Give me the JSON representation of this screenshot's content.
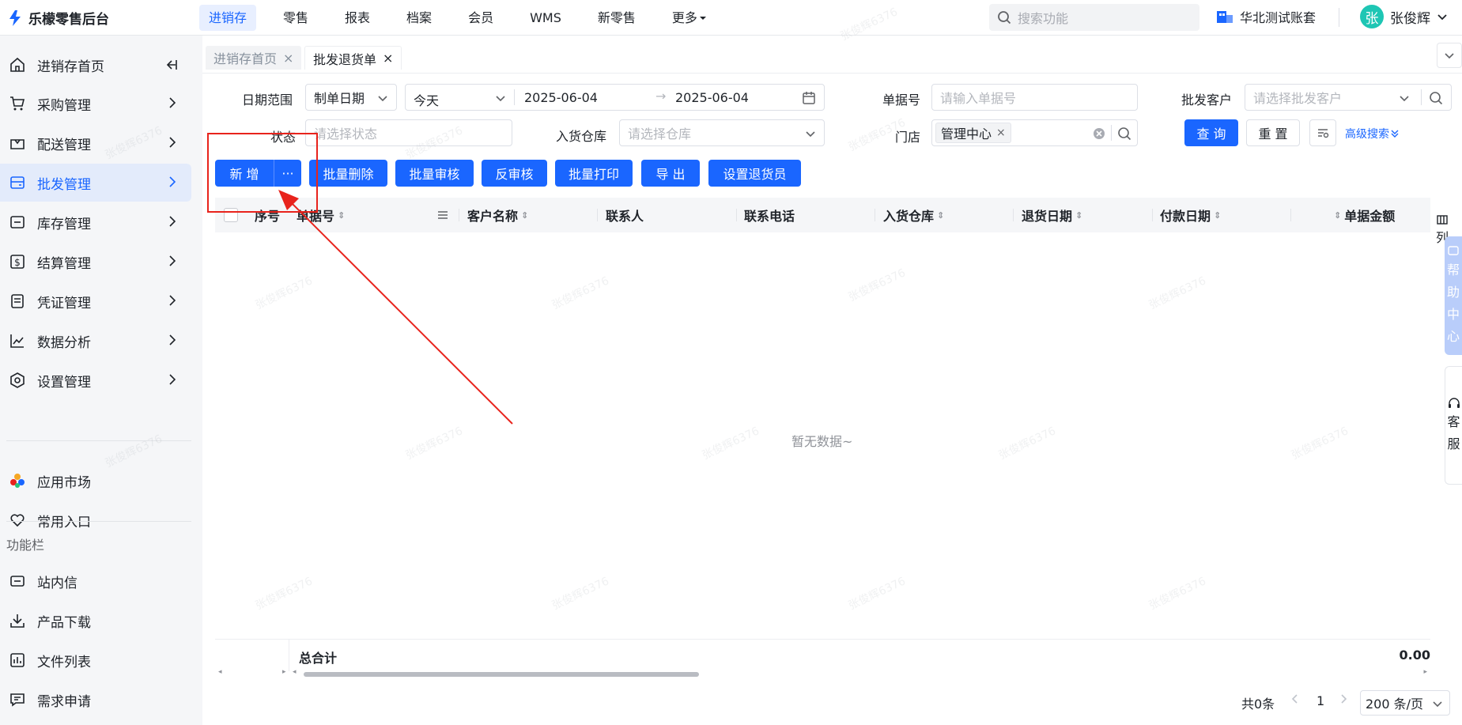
{
  "app": {
    "title": "乐檬零售后台"
  },
  "top_nav": {
    "items": [
      "进销存",
      "零售",
      "报表",
      "档案",
      "会员",
      "WMS",
      "新零售"
    ],
    "more": "更多",
    "search_placeholder": "搜索功能",
    "account": "华北测试账套",
    "user_initial": "张",
    "user_name": "张俊辉"
  },
  "sidebar": {
    "items": [
      "进销存首页",
      "采购管理",
      "配送管理",
      "批发管理",
      "库存管理",
      "结算管理",
      "凭证管理",
      "数据分析",
      "设置管理"
    ],
    "active_index": 3,
    "extra_items": [
      "应用市场",
      "常用入口"
    ],
    "section_label": "功能栏",
    "function_items": [
      "站内信",
      "产品下载",
      "文件列表",
      "需求申请"
    ]
  },
  "tabs": [
    {
      "label": "进销存首页",
      "active": false
    },
    {
      "label": "批发退货单",
      "active": true
    }
  ],
  "filters": {
    "date_range_label": "日期范围",
    "date_type": "制单日期",
    "date_preset": "今天",
    "date_start": "2025-06-04",
    "date_end": "2025-06-04",
    "doc_no_label": "单据号",
    "doc_no_placeholder": "请输入单据号",
    "customer_label": "批发客户",
    "customer_placeholder": "请选择批发客户",
    "status_label": "状态",
    "status_placeholder": "请选择状态",
    "warehouse_label": "入货仓库",
    "warehouse_placeholder": "请选择仓库",
    "store_label": "门店",
    "store_tag": "管理中心",
    "query_button": "查 询",
    "reset_button": "重 置",
    "advanced_link": "高级搜索"
  },
  "toolbar": {
    "add": "新 增",
    "more": "···",
    "batch_delete": "批量删除",
    "batch_audit": "批量审核",
    "unaudit": "反审核",
    "batch_print": "批量打印",
    "export": "导 出",
    "set_returner": "设置退货员"
  },
  "table": {
    "columns": [
      "序号",
      "单据号",
      "客户名称",
      "联系人",
      "联系电话",
      "入货仓库",
      "退货日期",
      "付款日期",
      "单据金额"
    ],
    "empty_text": "暂无数据~",
    "total_label": "总合计",
    "total_value": "0.00",
    "column_setting": "列"
  },
  "floats": {
    "help": [
      "帮",
      "助",
      "中",
      "心"
    ],
    "service": [
      "客",
      "服"
    ]
  },
  "pagination": {
    "total": "共0条",
    "page": "1",
    "page_size": "200 条/页"
  },
  "watermark": "张俊辉6376",
  "colors": {
    "primary": "#1a66ff",
    "annotation": "#e8231c"
  }
}
